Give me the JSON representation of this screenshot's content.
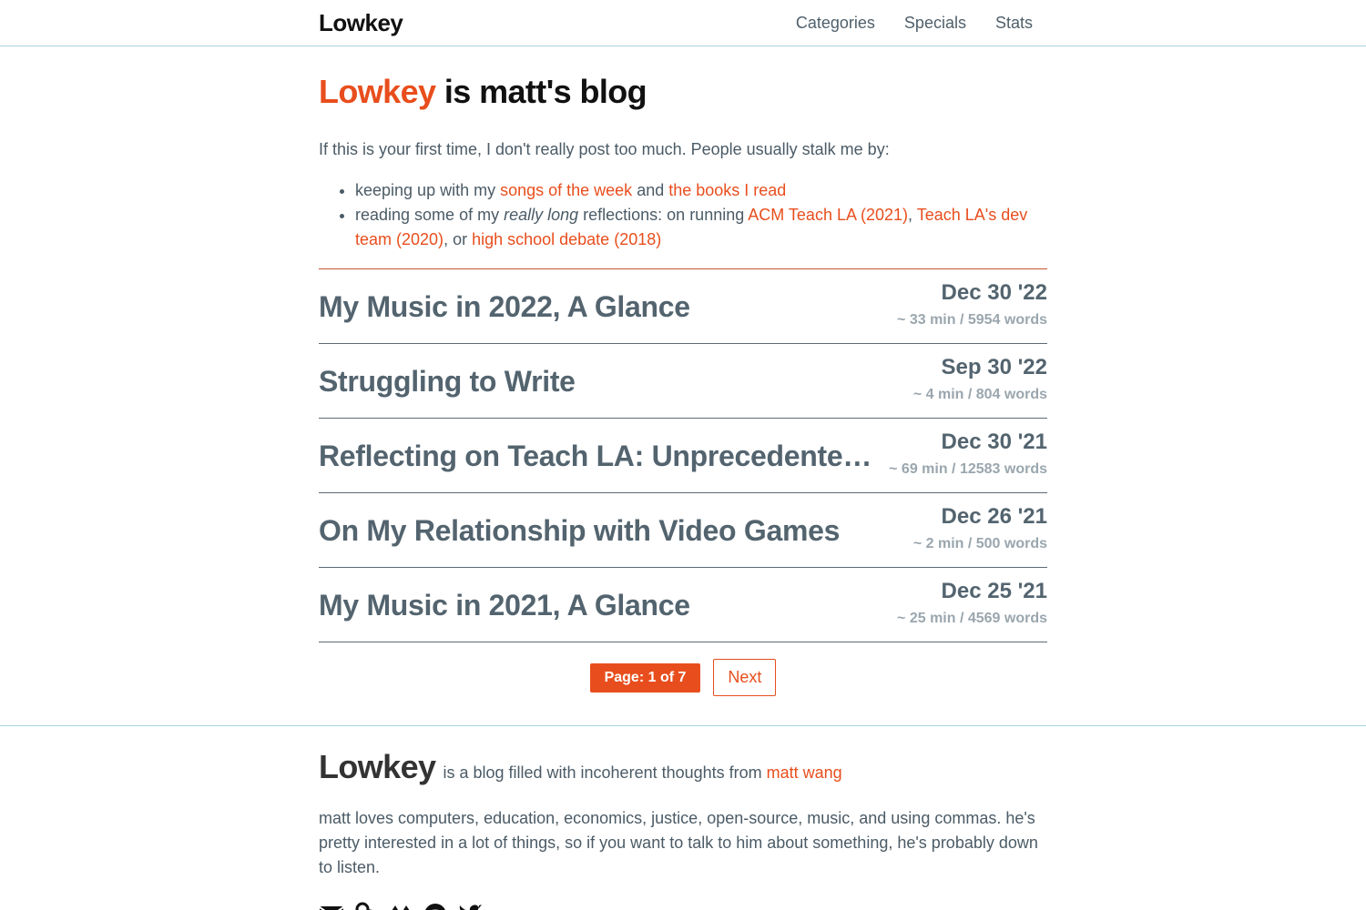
{
  "header": {
    "brand": "Lowkey",
    "nav": [
      "Categories",
      "Specials",
      "Stats"
    ]
  },
  "hero": {
    "title_accent": "Lowkey",
    "title_rest": " is matt's blog"
  },
  "intro": {
    "text": "If this is your first time, I don't really post too much. People usually stalk me by:",
    "bullet1": {
      "prefix": "keeping up with my ",
      "link1": "songs of the week",
      "middle": " and ",
      "link2": "the books I read"
    },
    "bullet2": {
      "prefix": "reading some of my ",
      "emph": "really long",
      "middle": " reflections: on running ",
      "link1": "ACM Teach LA (2021)",
      "sep1": ", ",
      "link2": "Teach LA's dev team (2020)",
      "sep2": ", or ",
      "link3": "high school debate (2018)"
    }
  },
  "posts": [
    {
      "title": "My Music in 2022, A Glance",
      "date": "Dec 30 '22",
      "meta": "~ 33 min / 5954 words"
    },
    {
      "title": "Struggling to Write",
      "date": "Sep 30 '22",
      "meta": "~ 4 min / 804 words"
    },
    {
      "title": "Reflecting on Teach LA: Unprecedented Times",
      "date": "Dec 30 '21",
      "meta": "~ 69 min / 12583 words"
    },
    {
      "title": "On My Relationship with Video Games",
      "date": "Dec 26 '21",
      "meta": "~ 2 min / 500 words"
    },
    {
      "title": "My Music in 2021, A Glance",
      "date": "Dec 25 '21",
      "meta": "~ 25 min / 4569 words"
    }
  ],
  "pager": {
    "label": "Page: 1 of 7",
    "next": "Next"
  },
  "footer": {
    "brand": "Lowkey",
    "tagline": "is a blog filled with incoherent thoughts from ",
    "author": "matt wang",
    "bio": "matt loves computers, education, economics, justice, open-source, music, and using commas. he's pretty interested in a lot of things, so if you want to talk to him about something, he's probably down to listen.",
    "social_icons": [
      "mail-icon",
      "link-icon",
      "github-icon",
      "spotify-icon",
      "twitter-icon"
    ]
  },
  "colors": {
    "accent": "#e84e1d",
    "text": "#4b5b66",
    "post_title": "#53646f",
    "meta": "#9aa6ae"
  }
}
